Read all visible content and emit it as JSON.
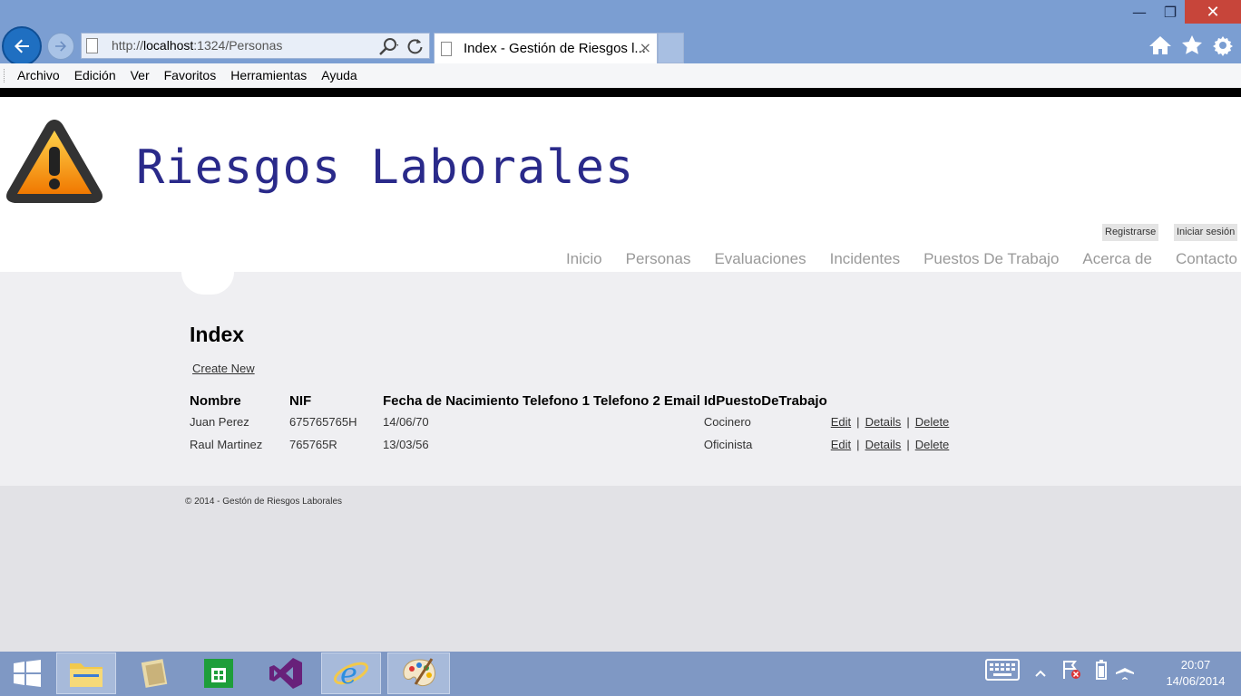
{
  "browser": {
    "url_prefix": "http://",
    "url_host": "localhost",
    "url_rest": ":1324/Personas",
    "tab_title": "Index - Gestión de Riesgos l...",
    "tab_close": "×",
    "window_close": "✕",
    "menu": [
      "Archivo",
      "Edición",
      "Ver",
      "Favoritos",
      "Herramientas",
      "Ayuda"
    ]
  },
  "site": {
    "title": "Riesgos Laborales",
    "auth": {
      "register": "Registrarse",
      "login": "Iniciar sesión"
    },
    "nav": [
      "Inicio",
      "Personas",
      "Evaluaciones",
      "Incidentes",
      "Puestos De Trabajo",
      "Acerca de",
      "Contacto"
    ]
  },
  "page": {
    "heading": "Index",
    "create_link": "Create New",
    "columns": [
      "Nombre",
      "NIF",
      "Fecha de Nacimiento",
      "Telefono 1",
      "Telefono 2",
      "Email",
      "IdPuestoDeTrabajo"
    ],
    "rows": [
      {
        "nombre": "Juan Perez",
        "nif": "675765765H",
        "fecha": "14/06/70",
        "tel1": "",
        "tel2": "",
        "email": "",
        "puesto": "Cocinero"
      },
      {
        "nombre": "Raul Martinez",
        "nif": "765765R",
        "fecha": "13/03/56",
        "tel1": "",
        "tel2": "",
        "email": "",
        "puesto": "Oficinista"
      }
    ],
    "actions": {
      "edit": "Edit",
      "details": "Details",
      "delete": "Delete",
      "separator": "|"
    }
  },
  "footer": {
    "copyright": "© 2014 - Gestón de Riesgos Laborales"
  },
  "taskbar": {
    "time": "20:07",
    "date": "14/06/2014"
  },
  "colors": {
    "title_text": "#2a2a8a",
    "browser_frame": "#7b9ed2",
    "close_button": "#c7453a",
    "content_bg": "#efeff2"
  }
}
